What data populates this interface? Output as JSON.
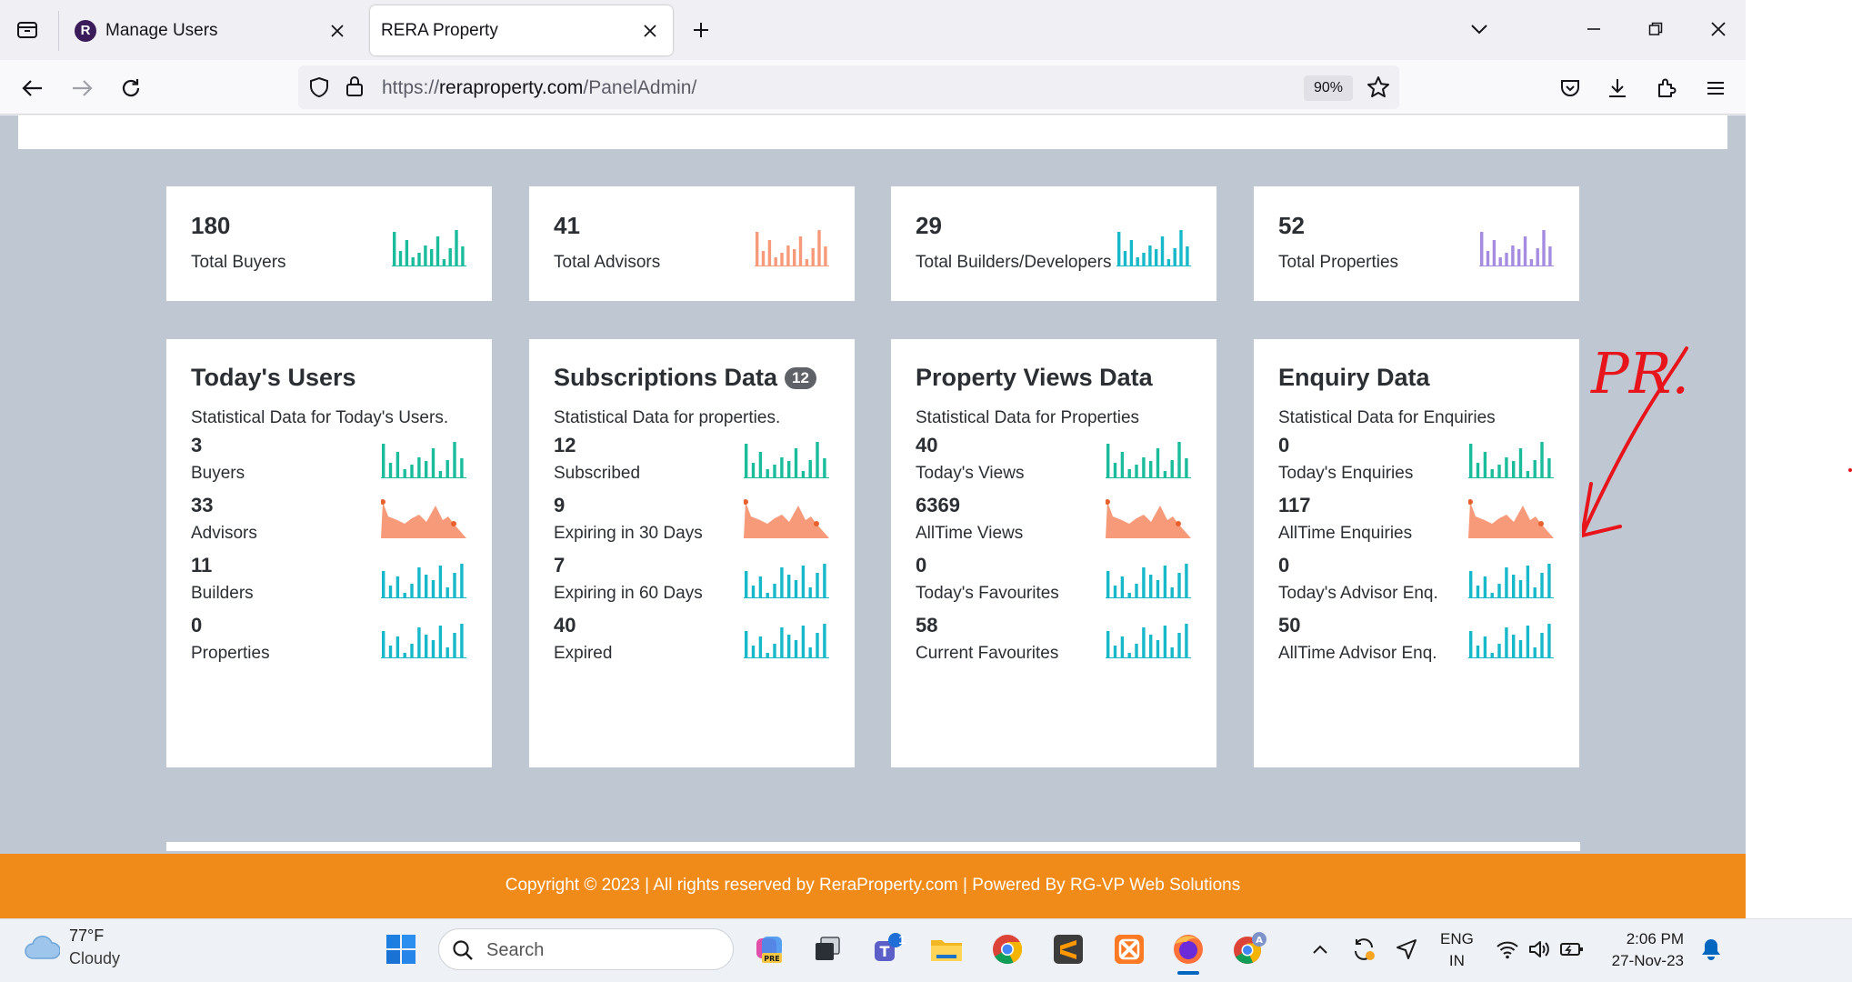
{
  "browser": {
    "tabs": [
      {
        "title": "Manage Users",
        "active": false,
        "favicon": "R"
      },
      {
        "title": "RERA Property",
        "active": true
      }
    ],
    "url_prefix": "https://",
    "url_domain": "reraproperty.com",
    "url_path": "/PanelAdmin/",
    "zoom": "90%"
  },
  "stats": [
    {
      "value": "180",
      "label": "Total Buyers",
      "color": "#1abc9c"
    },
    {
      "value": "41",
      "label": "Total Advisors",
      "color": "#f79a7a"
    },
    {
      "value": "29",
      "label": "Total Builders/Developers",
      "color": "#17b8c9"
    },
    {
      "value": "52",
      "label": "Total Properties",
      "color": "#a58ce0"
    }
  ],
  "cards": [
    {
      "title": "Today's Users",
      "badge": "",
      "subtitle": "Statistical Data for Today's Users.",
      "rows": [
        {
          "value": "3",
          "label": "Buyers",
          "chart": "bar-green"
        },
        {
          "value": "33",
          "label": "Advisors",
          "chart": "area-orange"
        },
        {
          "value": "11",
          "label": "Builders",
          "chart": "bar-cyan"
        },
        {
          "value": "0",
          "label": "Properties",
          "chart": "bar-cyan"
        }
      ]
    },
    {
      "title": "Subscriptions Data",
      "badge": "12",
      "subtitle": "Statistical Data for properties.",
      "rows": [
        {
          "value": "12",
          "label": "Subscribed",
          "chart": "bar-green"
        },
        {
          "value": "9",
          "label": "Expiring in 30 Days",
          "chart": "area-orange"
        },
        {
          "value": "7",
          "label": "Expiring in 60 Days",
          "chart": "bar-cyan"
        },
        {
          "value": "40",
          "label": "Expired",
          "chart": "bar-cyan"
        }
      ]
    },
    {
      "title": "Property Views Data",
      "badge": "",
      "subtitle": "Statistical Data for Properties",
      "rows": [
        {
          "value": "40",
          "label": "Today's Views",
          "chart": "bar-green"
        },
        {
          "value": "6369",
          "label": "AllTime Views",
          "chart": "area-orange"
        },
        {
          "value": "0",
          "label": "Today's Favourites",
          "chart": "bar-cyan"
        },
        {
          "value": "58",
          "label": "Current Favourites",
          "chart": "bar-cyan"
        }
      ]
    },
    {
      "title": "Enquiry Data",
      "badge": "",
      "subtitle": "Statistical Data for Enquiries",
      "rows": [
        {
          "value": "0",
          "label": "Today's Enquiries",
          "chart": "bar-green"
        },
        {
          "value": "117",
          "label": "AllTime Enquiries",
          "chart": "area-orange"
        },
        {
          "value": "0",
          "label": "Today's Advisor Enq.",
          "chart": "bar-cyan"
        },
        {
          "value": "50",
          "label": "AllTime Advisor Enq.",
          "chart": "bar-cyan"
        }
      ]
    }
  ],
  "footer": {
    "text": "Copyright © 2023 | All rights reserved by ReraProperty.com | Powered By RG-VP Web Solutions"
  },
  "annotation": {
    "text": "PR."
  },
  "taskbar": {
    "weather_temp": "77°F",
    "weather_desc": "Cloudy",
    "search_placeholder": "Search",
    "teams_badge": "1",
    "lang_line1": "ENG",
    "lang_line2": "IN",
    "time": "2:06 PM",
    "date": "27-Nov-23"
  },
  "colors": {
    "page_bg": "#bfc8d2",
    "footer_bg": "#f08a18",
    "green": "#1abc9c",
    "orange": "#f79a7a",
    "cyan": "#17b8c9",
    "purple": "#a58ce0",
    "annotation_red": "#e8141c"
  }
}
